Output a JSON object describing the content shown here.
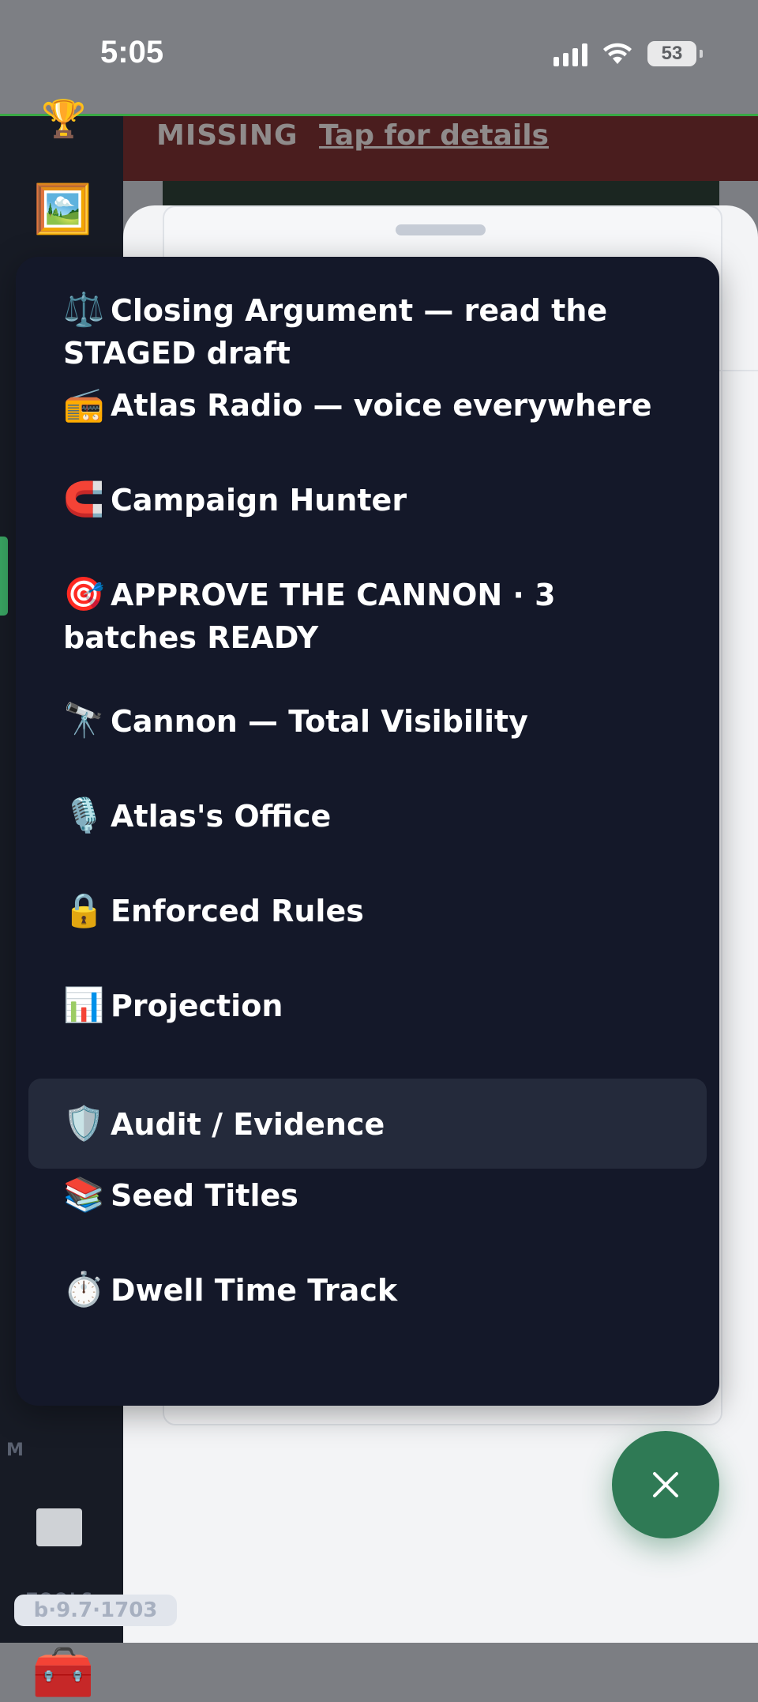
{
  "status_bar": {
    "time": "5:05",
    "battery": "53"
  },
  "banner": {
    "missing": "MISSING",
    "details_link": "Tap for details"
  },
  "sidebar": {
    "section_tools": "TOOLS",
    "letter_m": "M"
  },
  "menu": {
    "items": [
      {
        "icon": "⚖️",
        "label": "Closing Argument — read the STAGED draft",
        "selected": false
      },
      {
        "icon": "📻",
        "label": "Atlas Radio — voice everywhere",
        "selected": false
      },
      {
        "icon": "🧲",
        "label": "Campaign Hunter",
        "selected": false
      },
      {
        "icon": "🎯",
        "label": "APPROVE THE CANNON · 3 batches READY",
        "selected": false
      },
      {
        "icon": "🔭",
        "label": "Cannon — Total Visibility",
        "selected": false
      },
      {
        "icon": "🎙️",
        "label": "Atlas's Office",
        "selected": false
      },
      {
        "icon": "🔒",
        "label": "Enforced Rules",
        "selected": false
      },
      {
        "icon": "📊",
        "label": "Projection",
        "selected": false
      },
      {
        "icon": "🛡️",
        "label": "Audit / Evidence",
        "selected": true
      },
      {
        "icon": "📚",
        "label": "Seed Titles",
        "selected": false
      },
      {
        "icon": "⏱️",
        "label": "Dwell Time Track",
        "selected": false
      }
    ]
  },
  "fab": {
    "icon": "close-icon"
  },
  "version": "b·9.7·1703",
  "colors": {
    "accent": "#2f7a55",
    "menu_bg": "#141829",
    "selected_bg": "#242a3b",
    "banner_bg": "#4a1d1e"
  }
}
